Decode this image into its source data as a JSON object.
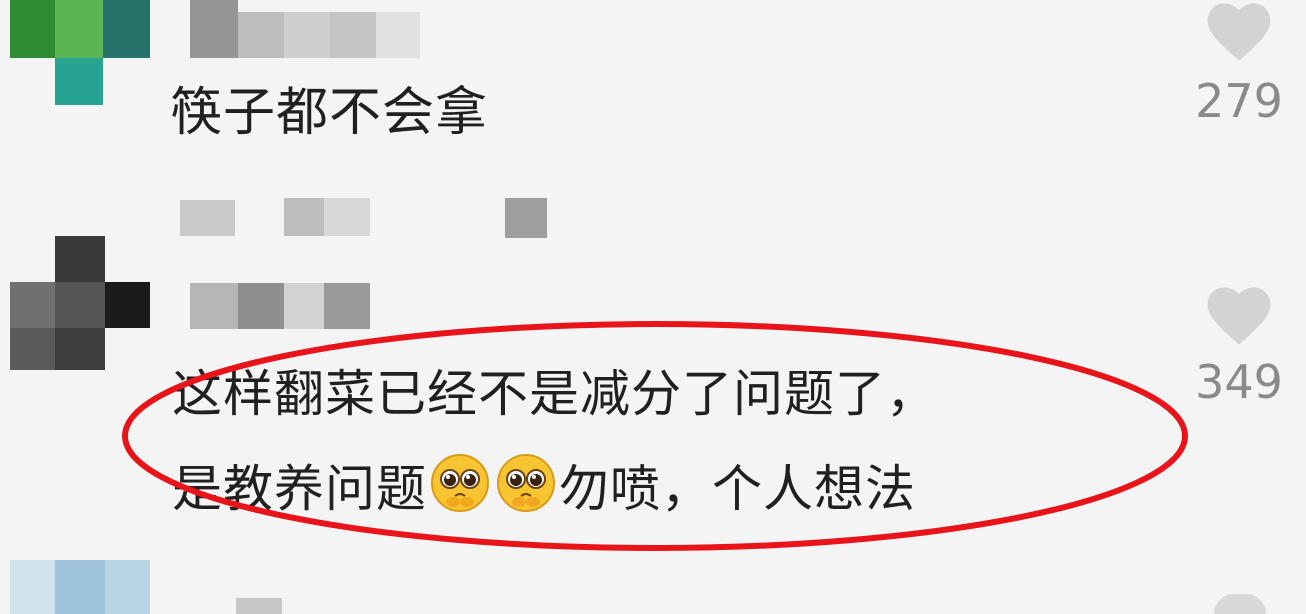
{
  "comments": [
    {
      "text": "筷子都不会拿",
      "likes": "279"
    },
    {
      "line1": "这样翻菜已经不是减分了问题了，",
      "line2_a": "是教养问题",
      "line2_b": "勿喷，个人想法",
      "likes": "349"
    }
  ],
  "icons": {
    "like": "heart-icon",
    "emoji": "pleading-face-emoji"
  },
  "colors": {
    "highlight": "#e8141a",
    "like_icon": "#d3d3d3",
    "text": "#202020"
  }
}
